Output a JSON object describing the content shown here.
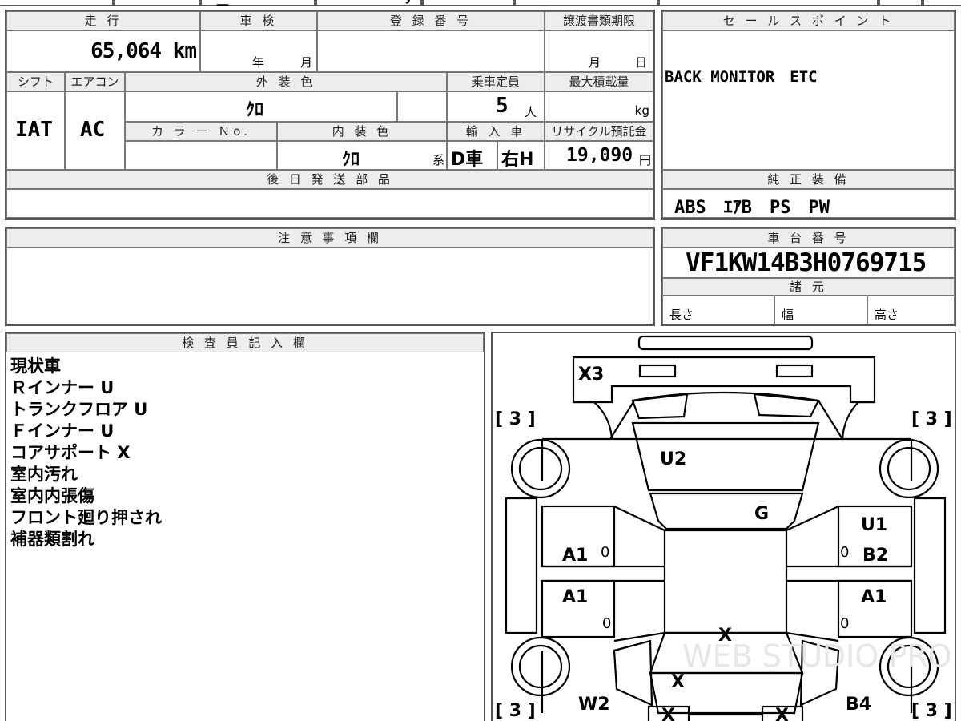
{
  "top_strip": {
    "fragment_a": "二",
    "fragment_b": "y"
  },
  "labels": {
    "mileage": "走 行",
    "inspection": "車 検",
    "registration": "登 録 番 号",
    "transfer_deadline": "譲渡書類期限",
    "shift": "シフト",
    "aircon": "エアコン",
    "exterior_color": "外 装 色",
    "capacity": "乗車定員",
    "max_load": "最大積載量",
    "color_no": "カ ラ ー Ｎo.",
    "interior_color": "内 装 色",
    "import": "輸 入 車",
    "recycle": "リサイクル預託金",
    "later_parts": "後 日 発 送 部 品",
    "sales_point": "セ ー ル ス ポ イ ン ト",
    "factory_equipment": "純 正 装 備",
    "notes": "注 意 事 項 欄",
    "chassis_no": "車 台 番 号",
    "specs": "諸 元",
    "length": "長さ",
    "width": "幅",
    "height": "高さ",
    "inspector": "検 査 員 記 入 欄",
    "year": "年",
    "month": "月",
    "day": "日",
    "persons": "人",
    "kg": "kg",
    "kei": "系",
    "yen": "円"
  },
  "values": {
    "mileage": "65,064 km",
    "shift": "IAT",
    "aircon": "AC",
    "exterior_color": "ｸﾛ",
    "capacity": "5",
    "interior_color": "ｸﾛ",
    "import_type": "D車",
    "handle": "右H",
    "recycle_fee": "19,090",
    "sales_point": "BACK MONITOR　ETC",
    "factory_equipment": "ABS　ｴｱB　PS　PW",
    "chassis_no": "VF1KW14B3H0769715"
  },
  "inspector_notes": [
    "現状車",
    "Ｒインナー U",
    "トランクフロア U",
    "Ｆインナー U",
    "コアサポート X",
    "室内汚れ",
    "室内内張傷",
    "フロント廻り押され",
    "補器類割れ"
  ],
  "diagram": {
    "bracket_tl": "[ 3 ]",
    "bracket_tr": "[ 3 ]",
    "bracket_bl": "[ 3 ]",
    "bracket_br": "[ 3 ]",
    "marks": {
      "rear_bumper": "X3",
      "trunk": "U2",
      "roof_right": "G",
      "rear_right_top": "U1",
      "rear_right_mid": "B2",
      "rear_left_door": "A1",
      "front_left_door": "A1",
      "front_right_door": "A1",
      "hood_upper": "X",
      "hood_lower": "X",
      "front_left_fender": "W2",
      "front_right_fender": "B4",
      "front_left_bumper": "X",
      "front_right_bumper": "X",
      "zero_a": "0",
      "zero_b": "0",
      "zero_c": "0",
      "zero_d": "0"
    },
    "watermark": "WEB STUDIO PRO"
  }
}
